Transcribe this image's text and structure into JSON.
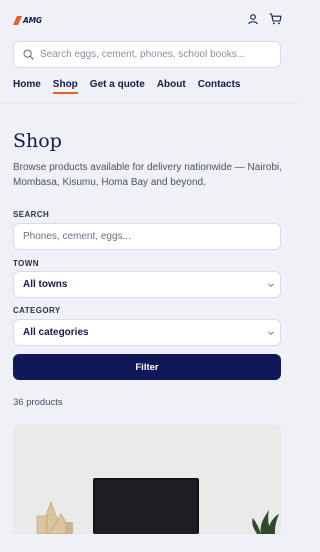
{
  "brand": {
    "logo_text": "AMG",
    "logo_accent": "#e85d26"
  },
  "header": {
    "search_placeholder": "Search eggs, cement, phones, school books...",
    "icons": [
      "user-icon",
      "cart-icon"
    ]
  },
  "nav": {
    "items": [
      "Home",
      "Shop",
      "Get a quote",
      "About",
      "Contacts"
    ],
    "active": "Shop"
  },
  "page": {
    "title": "Shop",
    "lead": "Browse products available for delivery nationwide — Nairobi, Mombasa, Kisumu, Homa Bay and beyond."
  },
  "filters": {
    "search_label": "SEARCH",
    "search_placeholder": "Phones, cement, eggs...",
    "town_label": "TOWN",
    "town_value": "All towns",
    "category_label": "CATEGORY",
    "category_value": "All categories",
    "filter_button": "Filter"
  },
  "results": {
    "count_text": "36 products"
  },
  "colors": {
    "primary": "#10185a",
    "accent": "#e85d26",
    "background": "#f0f1f6"
  }
}
